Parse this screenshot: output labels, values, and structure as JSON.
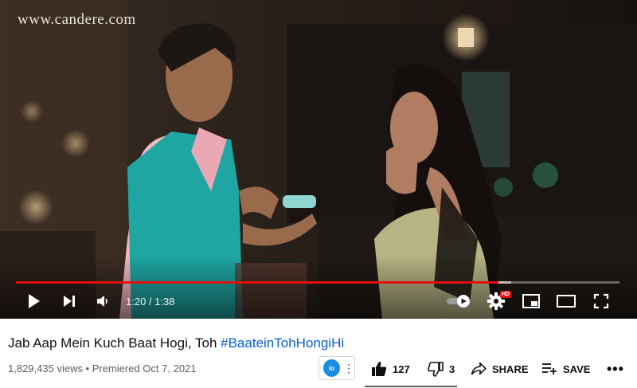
{
  "player": {
    "watermark": "www.candere.com",
    "progress_fraction": 0.8,
    "buffered_fraction": 0.82,
    "time_display": "1:20 / 1:38",
    "hd_badge": "HD",
    "colors": {
      "progress_played": "#e20f0f",
      "background": "#000000"
    },
    "controls": [
      "play-icon",
      "next-icon",
      "volume-icon",
      "autoplay-toggle",
      "settings-gear-icon",
      "miniplayer-icon",
      "theater-mode-icon",
      "fullscreen-icon"
    ]
  },
  "video": {
    "title_text": "Jab Aap Mein Kuch Baat Hogi, Toh ",
    "title_hashtag": "#BaateinTohHongiHi",
    "hashtag_color": "#065fd4",
    "views_line": "1,829,435 views • Premiered Oct 7, 2021"
  },
  "actions": {
    "like_count": "127",
    "dislike_count": "3",
    "share_label": "SHARE",
    "save_label": "SAVE",
    "channel_logo_text": "io"
  }
}
